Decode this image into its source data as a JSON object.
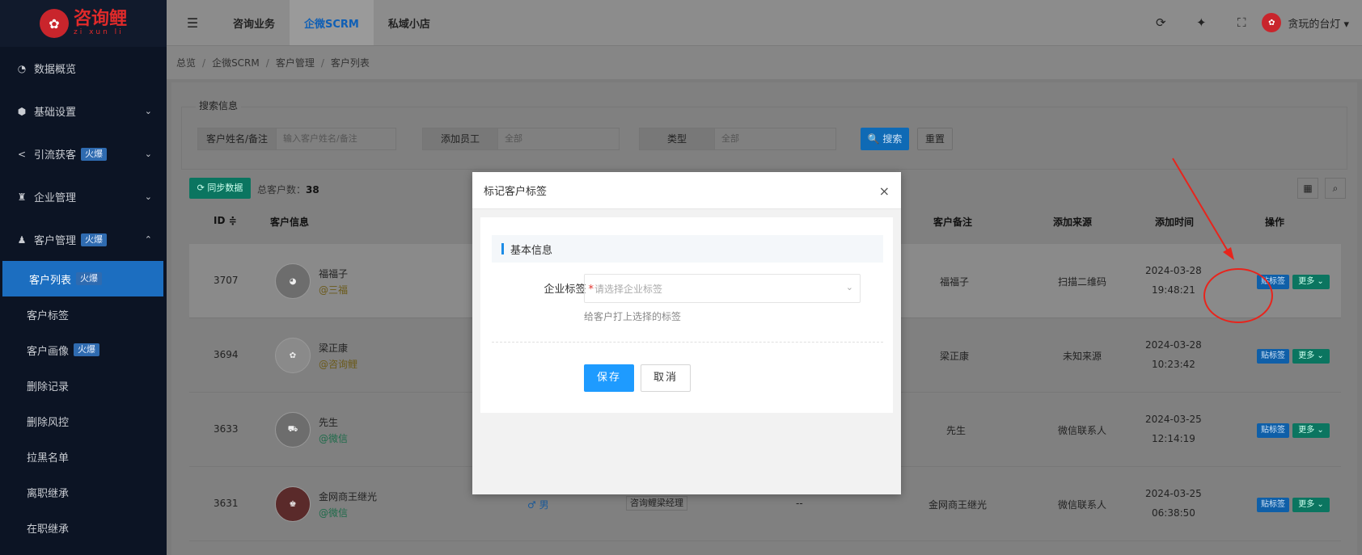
{
  "brand": {
    "logo_mark": "✿",
    "name": "咨询鲤",
    "subtitle": "zi xun li"
  },
  "sidebar": {
    "groups": [
      {
        "label": "数据概览",
        "icon": "◔"
      },
      {
        "label": "基础设置",
        "icon": "⬢",
        "chevron": "⌄"
      },
      {
        "label": "引流获客",
        "icon": "<",
        "badge": "火爆",
        "chevron": "⌄"
      },
      {
        "label": "企业管理",
        "icon": "♜",
        "chevron": "⌄"
      },
      {
        "label": "客户管理",
        "icon": "♟",
        "badge": "火爆",
        "chevron": "⌃"
      }
    ],
    "sub_items": [
      {
        "label": "客户列表",
        "badge": "火爆"
      },
      {
        "label": "客户标签"
      },
      {
        "label": "客户画像",
        "badge": "火爆"
      },
      {
        "label": "删除记录"
      },
      {
        "label": "删除风控"
      },
      {
        "label": "拉黑名单"
      },
      {
        "label": "离职继承"
      },
      {
        "label": "在职继承"
      }
    ]
  },
  "header": {
    "hamburger": "☰",
    "tabs": [
      "咨询业务",
      "企微SCRM",
      "私域小店"
    ],
    "icons": {
      "refresh": "⟳",
      "clean": "✦",
      "fullscreen": "⛶"
    },
    "user_name": "贪玩的台灯",
    "user_caret": "▾"
  },
  "breadcrumb": [
    "总览",
    "企微SCRM",
    "客户管理",
    "客户列表"
  ],
  "search": {
    "legend": "搜索信息",
    "field1_label": "客户姓名/备注",
    "field1_placeholder": "输入客户姓名/备注",
    "field2_label": "添加员工",
    "field2_value": "全部",
    "field3_label": "类型",
    "field3_value": "全部",
    "search_btn": "🔍 搜索",
    "reset_btn": "重置"
  },
  "toolbar": {
    "sync": "⟳ 同步数据",
    "total_label": "总客户数：",
    "total_value": "38"
  },
  "table": {
    "headers": {
      "id": "ID",
      "info": "客户信息",
      "remark": "客户备注",
      "source": "添加来源",
      "time": "添加时间",
      "ops": "操作"
    },
    "sort_icon": "≑",
    "rows": [
      {
        "id": "3707",
        "name": "福福子",
        "from": "@三福",
        "remark": "福福子",
        "source": "扫描二维码",
        "date": "2024-03-28",
        "clock": "19:48:21"
      },
      {
        "id": "3694",
        "name": "梁正康",
        "from": "@咨询鲤",
        "remark": "梁正康",
        "source": "未知来源",
        "date": "2024-03-28",
        "clock": "10:23:42"
      },
      {
        "id": "3633",
        "name": "先生",
        "from": "@微信",
        "remark": "先生",
        "source": "微信联系人",
        "date": "2024-03-25",
        "clock": "12:14:19"
      },
      {
        "id": "3631",
        "name": "金网商王继光",
        "from": "@微信",
        "gender": "♂ 男",
        "chip": "咨询鲤梁经理",
        "dash": "--",
        "remark": "金网商王继光",
        "source": "微信联系人",
        "date": "2024-03-25",
        "clock": "06:38:50"
      }
    ],
    "tag_btn": "贴标签",
    "more_btn": "更多 ⌄"
  },
  "modal": {
    "title": "标记客户标签",
    "close": "×",
    "section": "基本信息",
    "field_label": "企业标签",
    "required_mark": "*",
    "select_placeholder": "请选择企业标签",
    "select_caret": "⌄",
    "hint": "给客户打上选择的标签",
    "save": "保存",
    "cancel": "取消"
  }
}
